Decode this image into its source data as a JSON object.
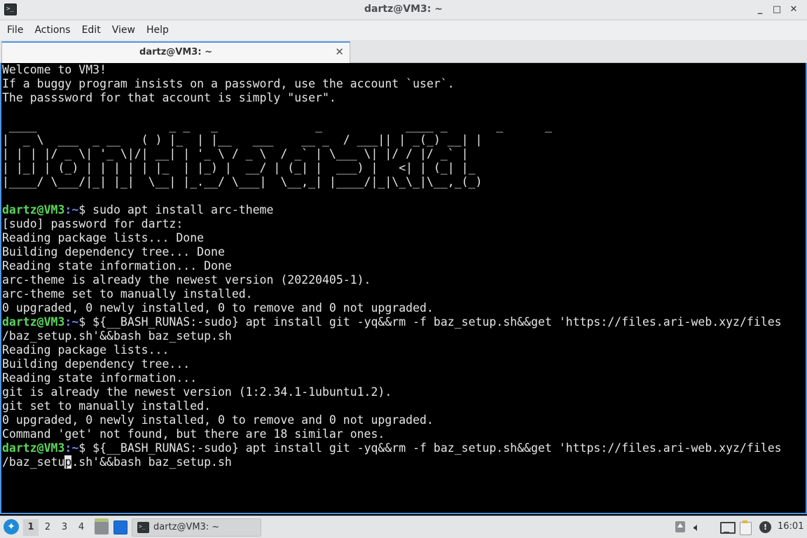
{
  "window": {
    "title": "dartz@VM3: ~",
    "controls": {
      "minimize": "_",
      "maximize": "□",
      "close": "✕"
    }
  },
  "menu": {
    "items": [
      "File",
      "Actions",
      "Edit",
      "View",
      "Help"
    ]
  },
  "tabs": [
    {
      "label": "dartz@VM3: ~",
      "close": "✕"
    }
  ],
  "terminal": {
    "prompt_user": "dartz@VM3",
    "prompt_path": ":~",
    "lines": [
      "Welcome to VM3!",
      "If a buggy program insists on a password, use the account `user`.",
      "The passsword for that account is simply \"user\".",
      "",
      " ____                   _ _   _              _            ____ _       _      _",
      "|  _ \\  ___  _ __   ( ) |_  | |__   ___    __ _  / ___|| | _(_) __| |",
      "| | | |/ _ \\| '_ \\|/| __| | '_ \\ / _ \\  / _` | \\___ \\| |/ / |/ _` |",
      "| |_| | (_) | | | | | |_  | |_) |  __/ | (_| |  ___) |   <| | (_| |_",
      "|____/ \\___/|_| |_|  \\__| |_.__/ \\___|  \\__,_| |____/|_|\\_\\_|\\__,_(_)",
      ""
    ],
    "session1": {
      "command": "$ sudo apt install arc-theme",
      "output": [
        "[sudo] password for dartz:",
        "Reading package lists... Done",
        "Building dependency tree... Done",
        "Reading state information... Done",
        "arc-theme is already the newest version (20220405-1).",
        "arc-theme set to manually installed.",
        "0 upgraded, 0 newly installed, 0 to remove and 0 not upgraded."
      ]
    },
    "session2": {
      "command": "$ ${__BASH_RUNAS:-sudo} apt install git -yq&&rm -f baz_setup.sh&&get 'https://files.ari-web.xyz/files",
      "command_cont": "/baz_setup.sh'&&bash baz_setup.sh",
      "output": [
        "Reading package lists...",
        "Building dependency tree...",
        "Reading state information...",
        "git is already the newest version (1:2.34.1-1ubuntu1.2).",
        "git set to manually installed.",
        "0 upgraded, 0 newly installed, 0 to remove and 0 not upgraded.",
        "Command 'get' not found, but there are 18 similar ones."
      ]
    },
    "session3": {
      "command": "$ ${__BASH_RUNAS:-sudo} apt install git -yq&&rm -f baz_setup.sh&&get 'https://files.ari-web.xyz/files",
      "input_before_cursor": "/baz_setu",
      "cursor_char": "p",
      "input_after_cursor": ".sh'&&bash baz_setup.sh"
    }
  },
  "taskbar": {
    "workspaces": [
      "1",
      "2",
      "3",
      "4"
    ],
    "active_workspace": "1",
    "task_label": "dartz@VM3: ~",
    "clock": "16:01",
    "icons": [
      "start-menu-icon",
      "file-manager-icon",
      "show-desktop-icon",
      "terminal-icon",
      "tray-up-icon",
      "volume-icon",
      "network-icon",
      "clipboard-icon",
      "info-icon"
    ]
  }
}
